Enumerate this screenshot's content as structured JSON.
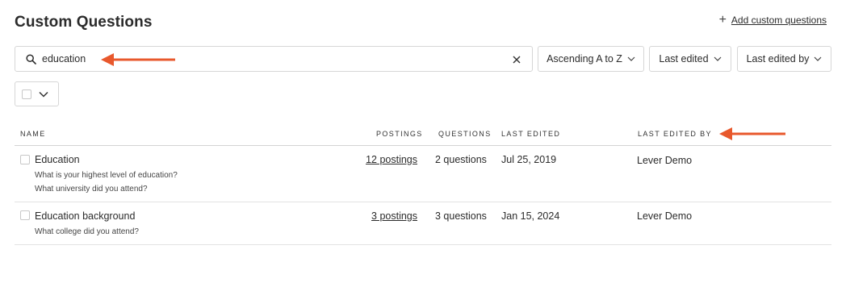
{
  "header": {
    "title": "Custom Questions",
    "add_label": "Add custom questions"
  },
  "search": {
    "value": "education",
    "placeholder": ""
  },
  "filters": {
    "sort_label": "Ascending A to Z",
    "last_edited_label": "Last edited",
    "last_edited_by_label": "Last edited by"
  },
  "table": {
    "columns": {
      "name": "NAME",
      "postings": "POSTINGS",
      "questions": "QUESTIONS",
      "last_edited": "LAST EDITED",
      "last_edited_by": "LAST EDITED BY"
    },
    "rows": [
      {
        "title": "Education",
        "subtitles": [
          "What is your highest level of education?",
          "What university did you attend?"
        ],
        "postings": "12 postings",
        "questions": "2 questions",
        "last_edited": "Jul 25, 2019",
        "last_edited_by": "Lever Demo"
      },
      {
        "title": "Education background",
        "subtitles": [
          "What college did you attend?"
        ],
        "postings": "3 postings",
        "questions": "3 questions",
        "last_edited": "Jan 15, 2024",
        "last_edited_by": "Lever Demo"
      }
    ]
  },
  "icons": {
    "search": "search-icon",
    "clear": "close-icon",
    "add": "plus-icon",
    "chevron": "chevron-down-icon",
    "annotation": "arrow-left-icon"
  },
  "colors": {
    "annotation_arrow": "#e8582c",
    "border": "#d6d6d6",
    "text": "#2b2b2b"
  }
}
